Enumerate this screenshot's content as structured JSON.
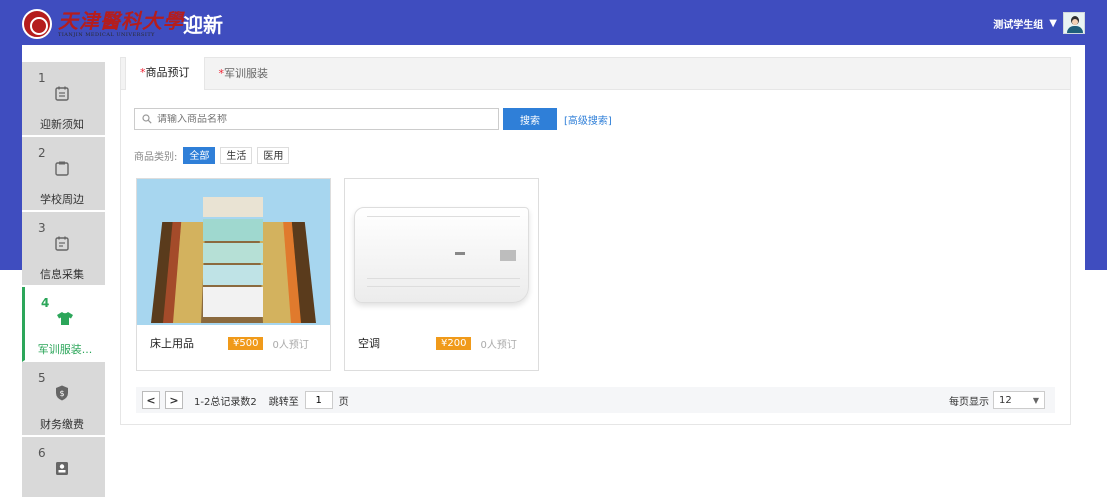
{
  "header": {
    "logo_cn": "天津醫科大學",
    "logo_en": "TIANJIN MEDICAL UNIVERSITY",
    "app_title": "迎新",
    "user_name": "测试学生组",
    "user_caret": "▼"
  },
  "steps": [
    {
      "num": "1",
      "label": "迎新须知",
      "icon": "notice-icon"
    },
    {
      "num": "2",
      "label": "学校周边",
      "icon": "clipboard-icon"
    },
    {
      "num": "3",
      "label": "信息采集",
      "icon": "form-icon"
    },
    {
      "num": "4",
      "label": "军训服装...",
      "icon": "tshirt-icon"
    },
    {
      "num": "5",
      "label": "财务缴费",
      "icon": "payment-shield-icon"
    },
    {
      "num": "6",
      "label": "",
      "icon": "id-card-icon"
    }
  ],
  "tabs": [
    {
      "req": "*",
      "label": "商品预订"
    },
    {
      "req": "*",
      "label": "军训服装"
    }
  ],
  "search": {
    "placeholder": "请输入商品名称",
    "button": "搜索",
    "advanced": "[高级搜索]"
  },
  "categories": {
    "label": "商品类别:",
    "items": [
      "全部",
      "生活",
      "医用"
    ]
  },
  "products": [
    {
      "name": "床上用品",
      "price": "¥500",
      "booked": "0人预订"
    },
    {
      "name": "空调",
      "price": "¥200",
      "booked": "0人预订"
    }
  ],
  "pager": {
    "prev": "<",
    "next": ">",
    "info": "1-2总记录数2",
    "jump_label": "跳转至",
    "page": "1",
    "unit": "页",
    "size_label": "每页显示",
    "size_value": "12",
    "size_caret": "▼"
  },
  "colors": {
    "header_blue": "#3f4dbf",
    "accent_blue": "#2f7fd8",
    "active_green": "#2ca65a",
    "price_orange": "#f09a1a",
    "required_red": "#e22233"
  }
}
